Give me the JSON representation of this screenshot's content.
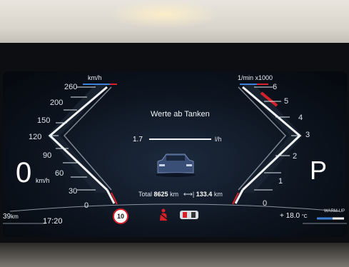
{
  "speedometer": {
    "unit": "km/h",
    "ticks": [
      "260",
      "200",
      "150",
      "120",
      "90",
      "60",
      "30",
      "0"
    ],
    "current_speed": "0",
    "current_unit": "km/h"
  },
  "tachometer": {
    "unit": "1/min x1000",
    "ticks": [
      "6",
      "5",
      "4",
      "3",
      "2",
      "1",
      "0"
    ],
    "gear": "P"
  },
  "center": {
    "title": "Werte ab Tanken",
    "consumption_value": "1.7",
    "consumption_unit": "l/h",
    "total_label": "Total",
    "total_value": "8625",
    "total_unit": "km",
    "trip_value": "133.4",
    "trip_unit": "km"
  },
  "status_bar": {
    "range_value": "39",
    "range_unit": "km",
    "time": "17:20",
    "speed_limit": "10",
    "outside_temp": "+ 18.0",
    "temp_unit": "°C",
    "warmup_label": "WARM-UP"
  },
  "colors": {
    "accent_red": "#d6212b",
    "accent_blue": "#3f7fd8",
    "screen_bg": "#0d141f",
    "gauge_white": "#f2f4f6"
  }
}
